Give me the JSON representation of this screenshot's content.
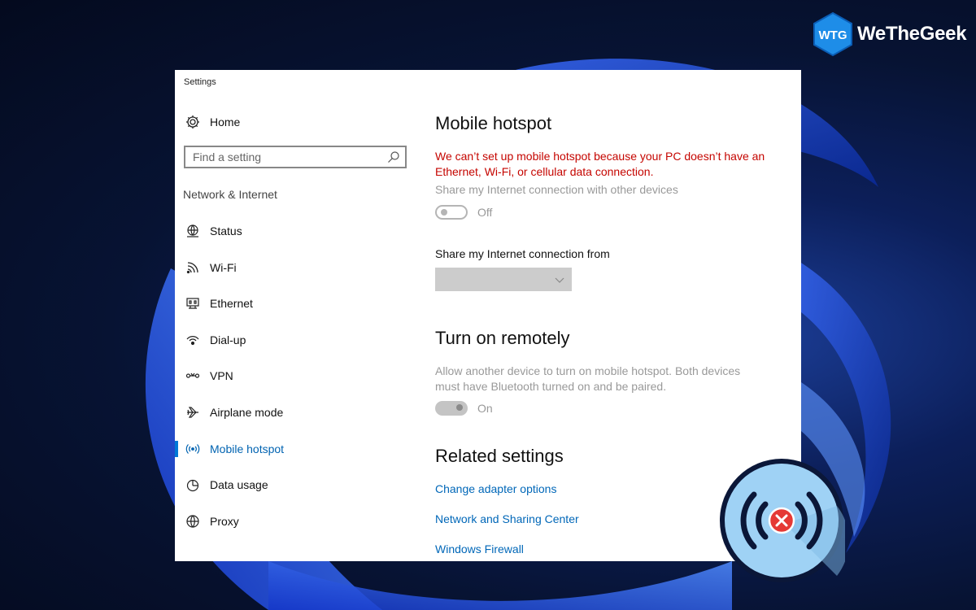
{
  "window": {
    "title": "Settings"
  },
  "brand": {
    "name": "WeTheGeek",
    "mark": "WTG"
  },
  "sidebar": {
    "home_label": "Home",
    "search_placeholder": "Find a setting",
    "section_label": "Network & Internet",
    "items": [
      {
        "label": "Status",
        "icon": "globe-status-icon"
      },
      {
        "label": "Wi-Fi",
        "icon": "wifi-icon"
      },
      {
        "label": "Ethernet",
        "icon": "ethernet-icon"
      },
      {
        "label": "Dial-up",
        "icon": "dial-up-icon"
      },
      {
        "label": "VPN",
        "icon": "vpn-icon"
      },
      {
        "label": "Airplane mode",
        "icon": "airplane-icon"
      },
      {
        "label": "Mobile hotspot",
        "icon": "hotspot-icon",
        "active": true
      },
      {
        "label": "Data usage",
        "icon": "pie-chart-icon"
      },
      {
        "label": "Proxy",
        "icon": "globe-icon"
      }
    ]
  },
  "main": {
    "title": "Mobile hotspot",
    "error": "We can’t set up mobile hotspot because your PC doesn’t have an Ethernet, Wi-Fi, or cellular data connection.",
    "share_label": "Share my Internet connection with other devices",
    "share_toggle": "Off",
    "share_from_label": "Share my Internet connection from",
    "share_from_value": "",
    "remote_title": "Turn on remotely",
    "remote_desc": "Allow another device to turn on mobile hotspot. Both devices must have Bluetooth turned on and be paired.",
    "remote_toggle": "On",
    "related_title": "Related settings",
    "related_links": [
      "Change adapter options",
      "Network and Sharing Center",
      "Windows Firewall"
    ]
  },
  "colors": {
    "accent": "#0078d7",
    "error": "#c50500",
    "link": "#0067b8",
    "badge": "#9fd2f5",
    "badge_x": "#e53935"
  }
}
